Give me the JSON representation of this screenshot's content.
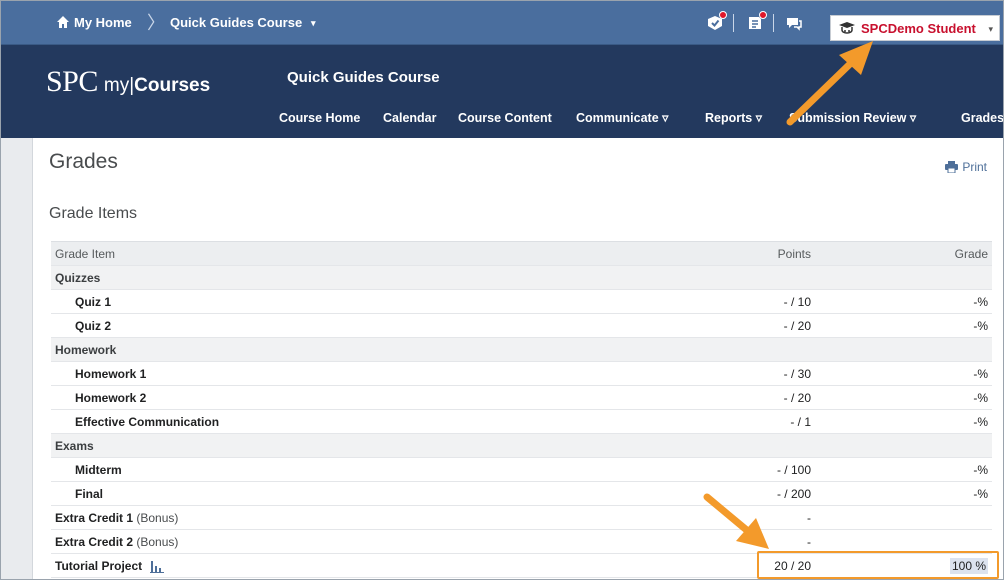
{
  "minibar": {
    "home_label": "My Home",
    "separator": "〉",
    "course_label": "Quick Guides Course",
    "course_caret": "▾",
    "user_name": "SPCDemo Student",
    "user_caret": "▾",
    "icons": [
      "home-icon",
      "subscription-alert-icon",
      "update-alert-icon",
      "message-alert-icon",
      "user-avatar-icon"
    ]
  },
  "header": {
    "logo_spc": "SPC",
    "logo_my": "my",
    "logo_bar": "|",
    "logo_courses": "Courses",
    "course_title": "Quick Guides Course",
    "nav": [
      "Course Home",
      "Calendar",
      "Course Content",
      "Communicate ▿",
      "Reports ▿",
      "Submission Review ▿",
      "Grades"
    ]
  },
  "page": {
    "title": "Grades",
    "print_label": "Print",
    "section_title": "Grade Items"
  },
  "table": {
    "columns": [
      "Grade Item",
      "Points",
      "Grade"
    ],
    "rows": [
      {
        "type": "category",
        "name": "Quizzes",
        "points": "",
        "grade": ""
      },
      {
        "type": "item",
        "name": "Quiz 1",
        "points": "- / 10",
        "grade": "-%"
      },
      {
        "type": "item",
        "name": "Quiz 2",
        "points": "- / 20",
        "grade": "-%"
      },
      {
        "type": "category",
        "name": "Homework",
        "points": "",
        "grade": ""
      },
      {
        "type": "item",
        "name": "Homework 1",
        "points": "- / 30",
        "grade": "-%"
      },
      {
        "type": "item",
        "name": "Homework 2",
        "points": "- / 20",
        "grade": "-%"
      },
      {
        "type": "item",
        "name": "Effective Communication",
        "points": "- / 1",
        "grade": "-%"
      },
      {
        "type": "category",
        "name": "Exams",
        "points": "",
        "grade": ""
      },
      {
        "type": "item",
        "name": "Midterm",
        "points": "- / 100",
        "grade": "-%"
      },
      {
        "type": "item",
        "name": "Final",
        "points": "- / 200",
        "grade": "-%"
      },
      {
        "type": "top",
        "name": "Extra Credit 1",
        "suffix": " (Bonus)",
        "points": "-",
        "grade": ""
      },
      {
        "type": "top",
        "name": "Extra Credit 2",
        "suffix": " (Bonus)",
        "points": "-",
        "grade": ""
      },
      {
        "type": "top",
        "name": "Tutorial Project",
        "points": "20 / 20",
        "grade": "100 %",
        "has_stats": true
      }
    ]
  },
  "colors": {
    "minibar": "#4a6e9e",
    "navband": "#23395e",
    "annotation": "#f39a2b",
    "user_name": "#c8102e",
    "alert_dot": "#e0172a"
  }
}
